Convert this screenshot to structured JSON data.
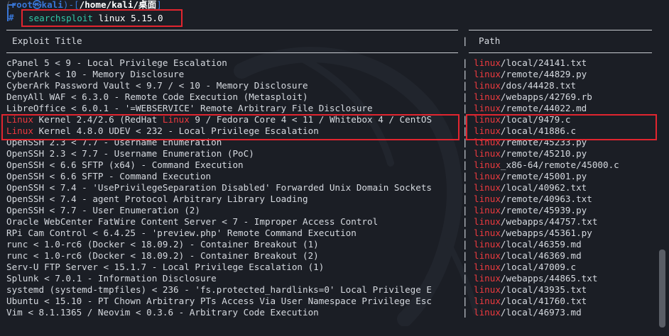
{
  "prompt": {
    "open": "(",
    "user_host": "root㉿kali",
    "sep": ")-[",
    "cwd": "/home/kali/桌面",
    "close": "]",
    "symbol": "#"
  },
  "command": {
    "tool": "searchsploit",
    "args": " linux 5.15.0"
  },
  "table": {
    "header_title": "Exploit Title",
    "header_path": "Path",
    "rows": [
      {
        "title": [
          {
            "t": "cPanel 5 < 9 - Local Privilege Escalation"
          }
        ],
        "path": [
          {
            "t": "linux",
            "hl": true
          },
          {
            "t": "/local/24141.txt"
          }
        ]
      },
      {
        "title": [
          {
            "t": "CyberArk < 10 - Memory Disclosure"
          }
        ],
        "path": [
          {
            "t": "linux",
            "hl": true
          },
          {
            "t": "/remote/44829.py"
          }
        ]
      },
      {
        "title": [
          {
            "t": "CyberArk Password Vault < 9.7 / < 10 - Memory Disclosure"
          }
        ],
        "path": [
          {
            "t": "linux",
            "hl": true
          },
          {
            "t": "/dos/44428.txt"
          }
        ]
      },
      {
        "title": [
          {
            "t": "DenyAll WAF < 6.3.0 - Remote Code Execution (Metasploit)"
          }
        ],
        "path": [
          {
            "t": "linux",
            "hl": true
          },
          {
            "t": "/webapps/42769.rb"
          }
        ]
      },
      {
        "title": [
          {
            "t": "LibreOffice < 6.0.1 - '=WEBSERVICE' Remote Arbitrary File Disclosure"
          }
        ],
        "path": [
          {
            "t": "linux",
            "hl": true
          },
          {
            "t": "/remote/44022.md"
          }
        ]
      },
      {
        "title": [
          {
            "t": "Linux",
            "hl": true
          },
          {
            "t": " Kernel 2.4/2.6 (RedHat "
          },
          {
            "t": "Linux",
            "hl": true
          },
          {
            "t": " 9 / Fedora Core 4 < 11 / Whitebox 4 / CentOS"
          }
        ],
        "path": [
          {
            "t": "linux",
            "hl": true
          },
          {
            "t": "/local/9479.c"
          }
        ]
      },
      {
        "title": [
          {
            "t": "Linux",
            "hl": true
          },
          {
            "t": " Kernel 4.8.0 UDEV < 232 - Local Privilege Escalation"
          }
        ],
        "path": [
          {
            "t": "linux",
            "hl": true
          },
          {
            "t": "/local/41886.c"
          }
        ]
      },
      {
        "title": [
          {
            "t": "OpenSSH 2.3 < 7.7 - Username Enumeration"
          }
        ],
        "path": [
          {
            "t": "linux",
            "hl": true
          },
          {
            "t": "/remote/45233.py"
          }
        ]
      },
      {
        "title": [
          {
            "t": "OpenSSH 2.3 < 7.7 - Username Enumeration (PoC)"
          }
        ],
        "path": [
          {
            "t": "linux",
            "hl": true
          },
          {
            "t": "/remote/45210.py"
          }
        ]
      },
      {
        "title": [
          {
            "t": "OpenSSH < 6.6 SFTP (x64) - Command Execution"
          }
        ],
        "path": [
          {
            "t": "linux",
            "hl": true
          },
          {
            "t": "_x86-64/remote/45000.c"
          }
        ]
      },
      {
        "title": [
          {
            "t": "OpenSSH < 6.6 SFTP - Command Execution"
          }
        ],
        "path": [
          {
            "t": "linux",
            "hl": true
          },
          {
            "t": "/remote/45001.py"
          }
        ]
      },
      {
        "title": [
          {
            "t": "OpenSSH < 7.4 - 'UsePrivilegeSeparation Disabled' Forwarded Unix Domain Sockets"
          }
        ],
        "path": [
          {
            "t": "linux",
            "hl": true
          },
          {
            "t": "/local/40962.txt"
          }
        ]
      },
      {
        "title": [
          {
            "t": "OpenSSH < 7.4 - agent Protocol Arbitrary Library Loading"
          }
        ],
        "path": [
          {
            "t": "linux",
            "hl": true
          },
          {
            "t": "/remote/40963.txt"
          }
        ]
      },
      {
        "title": [
          {
            "t": "OpenSSH < 7.7 - User Enumeration (2)"
          }
        ],
        "path": [
          {
            "t": "linux",
            "hl": true
          },
          {
            "t": "/remote/45939.py"
          }
        ]
      },
      {
        "title": [
          {
            "t": "Oracle WebCenter FatWire Content Server < 7 - Improper Access Control"
          }
        ],
        "path": [
          {
            "t": "linux",
            "hl": true
          },
          {
            "t": "/webapps/44757.txt"
          }
        ]
      },
      {
        "title": [
          {
            "t": "RPi Cam Control < 6.4.25 - 'preview.php' Remote Command Execution"
          }
        ],
        "path": [
          {
            "t": "linux",
            "hl": true
          },
          {
            "t": "/webapps/45361.py"
          }
        ]
      },
      {
        "title": [
          {
            "t": "runc < 1.0-rc6 (Docker < 18.09.2) - Container Breakout (1)"
          }
        ],
        "path": [
          {
            "t": "linux",
            "hl": true
          },
          {
            "t": "/local/46359.md"
          }
        ]
      },
      {
        "title": [
          {
            "t": "runc < 1.0-rc6 (Docker < 18.09.2) - Container Breakout (2)"
          }
        ],
        "path": [
          {
            "t": "linux",
            "hl": true
          },
          {
            "t": "/local/46369.md"
          }
        ]
      },
      {
        "title": [
          {
            "t": "Serv-U FTP Server < 15.1.7 - Local Privilege Escalation (1)"
          }
        ],
        "path": [
          {
            "t": "linux",
            "hl": true
          },
          {
            "t": "/local/47009.c"
          }
        ]
      },
      {
        "title": [
          {
            "t": "Splunk < 7.0.1 - Information Disclosure"
          }
        ],
        "path": [
          {
            "t": "linux",
            "hl": true
          },
          {
            "t": "/webapps/44865.txt"
          }
        ]
      },
      {
        "title": [
          {
            "t": "systemd (systemd-tmpfiles) < 236 - 'fs.protected_hardlinks=0' Local Privilege E"
          }
        ],
        "path": [
          {
            "t": "linux",
            "hl": true
          },
          {
            "t": "/local/43935.txt"
          }
        ]
      },
      {
        "title": [
          {
            "t": "Ubuntu < 15.10 - PT Chown Arbitrary PTs Access Via User Namespace Privilege Esc"
          }
        ],
        "path": [
          {
            "t": "linux",
            "hl": true
          },
          {
            "t": "/local/41760.txt"
          }
        ]
      },
      {
        "title": [
          {
            "t": "Vim < 8.1.1365 / Neovim < 0.3.6 - Arbitrary Code Execution"
          }
        ],
        "path": [
          {
            "t": "linux",
            "hl": true
          },
          {
            "t": "/local/46973.md"
          }
        ]
      }
    ]
  },
  "colors": {
    "background": "#1b1e25",
    "text": "#d6dae0",
    "highlight": "#ee3a3f",
    "prompt_blue": "#3976d6",
    "command_green": "#32c8a6",
    "annotation_box": "#e2252f"
  },
  "icons": {
    "background_logo": "kali-dragon-logo-icon"
  }
}
